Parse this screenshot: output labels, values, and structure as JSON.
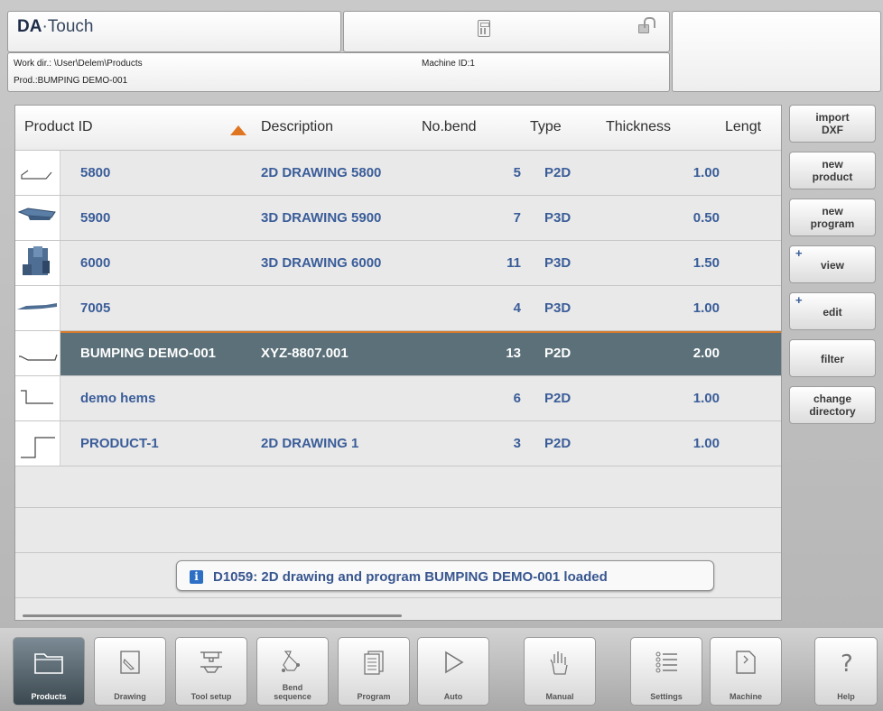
{
  "header": {
    "logo_brand": "DA",
    "logo_sep": "·",
    "logo_product": "Touch",
    "work_dir": "Work dir.: \\User\\Delem\\Products",
    "product": "Prod.:BUMPING DEMO-001",
    "machine_id": "Machine ID:1"
  },
  "table": {
    "columns": [
      "Product ID",
      "Description",
      "No.bend",
      "Type",
      "Thickness",
      "Lengt"
    ],
    "sort_indicator": "ascending",
    "rows": [
      {
        "id": "5800",
        "description": "2D DRAWING 5800",
        "bends": "5",
        "type": "P2D",
        "thickness": "1.00",
        "thumb": "profile-2d"
      },
      {
        "id": "5900",
        "description": "3D DRAWING 5900",
        "bends": "7",
        "type": "P3D",
        "thickness": "0.50",
        "thumb": "part-3d"
      },
      {
        "id": "6000",
        "description": "3D DRAWING 6000",
        "bends": "11",
        "type": "P3D",
        "thickness": "1.50",
        "thumb": "box-3d"
      },
      {
        "id": "7005",
        "description": "",
        "bends": "4",
        "type": "P3D",
        "thickness": "1.00",
        "thumb": "strip-3d"
      },
      {
        "id": "BUMPING DEMO-001",
        "description": "XYZ-8807.001",
        "bends": "13",
        "type": "P2D",
        "thickness": "2.00",
        "thumb": "curve-2d"
      },
      {
        "id": "demo hems",
        "description": "",
        "bends": "6",
        "type": "P2D",
        "thickness": "1.00",
        "thumb": "hem-2d"
      },
      {
        "id": "PRODUCT-1",
        "description": "2D DRAWING 1",
        "bends": "3",
        "type": "P2D",
        "thickness": "1.00",
        "thumb": "step-2d"
      }
    ],
    "selected_index": 4
  },
  "message": {
    "icon": "info-icon",
    "icon_glyph": "i",
    "text": "D1059: 2D drawing and program BUMPING DEMO-001 loaded"
  },
  "side_buttons": [
    {
      "label": "import\nDXF",
      "plus": false
    },
    {
      "label": "new\nproduct",
      "plus": false
    },
    {
      "label": "new\nprogram",
      "plus": false
    },
    {
      "label": "view",
      "plus": true
    },
    {
      "label": "edit",
      "plus": true
    },
    {
      "label": "filter",
      "plus": false
    },
    {
      "label": "change\ndirectory",
      "plus": false
    }
  ],
  "nav": [
    {
      "label": "Products",
      "icon": "folder-icon",
      "active": true
    },
    {
      "label": "Drawing",
      "icon": "pencil-icon",
      "active": false
    },
    {
      "label": "Tool setup",
      "icon": "tools-icon",
      "active": false
    },
    {
      "label": "Bend\nsequence",
      "icon": "sequence-icon",
      "active": false
    },
    {
      "label": "Program",
      "icon": "program-icon",
      "active": false
    },
    {
      "label": "Auto",
      "icon": "play-icon",
      "active": false
    },
    {
      "label": "Manual",
      "icon": "hand-icon",
      "active": false
    },
    {
      "label": "Settings",
      "icon": "settings-icon",
      "active": false
    },
    {
      "label": "Machine",
      "icon": "machine-icon",
      "active": false
    },
    {
      "label": "Help",
      "icon": "help-icon",
      "active": false
    }
  ],
  "colors": {
    "accent": "#e07521",
    "selected_row": "#5b7079",
    "link_text": "#3a5d99"
  }
}
